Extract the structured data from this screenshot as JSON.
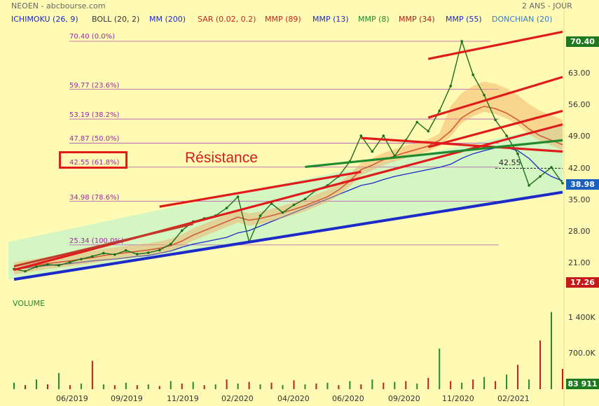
{
  "header": {
    "ticker": "NEOEN - abcbourse.com",
    "period": "2 ANS - JOUR"
  },
  "indicators": [
    {
      "label": "ICHIMOKU (26, 9)",
      "color": "#1b2ac8"
    },
    {
      "label": "BOLL (20, 2)",
      "color": "#333333"
    },
    {
      "label": "MM (200)",
      "color": "#1b2ac8"
    },
    {
      "label": "SAR (0.02, 0.2)",
      "color": "#d11d1d"
    },
    {
      "label": "MMP (89)",
      "color": "#d11d1d"
    },
    {
      "label": "MMP (13)",
      "color": "#1b2ac8"
    },
    {
      "label": "MMP (8)",
      "color": "#1f8a2e"
    },
    {
      "label": "MMP (34)",
      "color": "#a8201a"
    },
    {
      "label": "MMP (55)",
      "color": "#1b2ac8"
    },
    {
      "label": "DONCHIAN (20)",
      "color": "#3a7acb"
    }
  ],
  "price_tags": {
    "top": "70.40",
    "current": "38.98",
    "bottom": "17.26",
    "volume": "83 911"
  },
  "annotation": {
    "text": "Résistance",
    "dotted_level": "42.55"
  },
  "chart_data": {
    "type": "line",
    "title": "",
    "ylim": [
      17.26,
      70.4
    ],
    "yticks": [
      "70.40",
      "63.00",
      "56.00",
      "49.00",
      "42.00",
      "35.00",
      "28.00",
      "21.00"
    ],
    "ytick_values": [
      70.4,
      63,
      56,
      49,
      42,
      35,
      28,
      21
    ],
    "x_labels": [
      "06/2019",
      "09/2019",
      "11/2019",
      "02/2020",
      "04/2020",
      "06/2020",
      "09/2020",
      "11/2020",
      "02/2021"
    ],
    "fibonacci": [
      {
        "label": "70.40 (0.0%)",
        "value": 70.4
      },
      {
        "label": "59.77 (23.6%)",
        "value": 59.77
      },
      {
        "label": "53.19 (38.2%)",
        "value": 53.19
      },
      {
        "label": "47.87 (50.0%)",
        "value": 47.87
      },
      {
        "label": "42.55 (61.8%)",
        "value": 42.55
      },
      {
        "label": "34.98 (78.6%)",
        "value": 34.98
      },
      {
        "label": "25.34 (100.0%)",
        "value": 25.34
      }
    ],
    "price_series": {
      "name": "",
      "values": [
        20,
        19.5,
        20.5,
        21,
        20.8,
        21.5,
        22.2,
        22.8,
        23.5,
        23.2,
        24.1,
        23.3,
        23.6,
        24.2,
        25.5,
        28.5,
        30.5,
        31.2,
        31.8,
        33.5,
        36,
        26,
        31.8,
        34.5,
        32.5,
        34.2,
        35.5,
        37.5,
        38.5,
        40.5,
        43.8,
        49.5,
        46,
        49.5,
        45,
        48.5,
        52.5,
        50.5,
        55,
        60.5,
        70.4,
        63,
        58.5,
        53,
        49.5,
        45.5,
        38.5,
        40.5,
        42.5,
        38.98
      ]
    },
    "mm200": [
      20,
      20.2,
      20.5,
      20.8,
      21,
      21.2,
      21.5,
      21.8,
      22,
      22.2,
      22.5,
      22.8,
      23,
      23.5,
      24,
      24.8,
      25.5,
      26,
      26.5,
      27,
      28,
      28.5,
      29.5,
      30.5,
      31.5,
      32.5,
      33.5,
      34.5,
      35.5,
      36.5,
      37.5,
      38.5,
      39,
      39.8,
      40.5,
      41,
      41.5,
      42,
      42.5,
      43.2,
      44.5,
      45.5,
      46.2,
      46.8,
      46.9,
      46.2,
      44.5,
      42,
      40.5,
      39.5
    ],
    "mmp89": [
      20,
      20.4,
      20.8,
      21.2,
      21.5,
      21.8,
      22.2,
      22.5,
      23,
      23.3,
      23.6,
      23.9,
      24.2,
      24.6,
      25.2,
      26.2,
      27.5,
      28.5,
      29.5,
      30.5,
      31.5,
      30.8,
      31.2,
      31.8,
      32.5,
      33.2,
      34,
      35,
      36,
      37.5,
      39.5,
      42,
      43,
      44.2,
      45,
      45.8,
      46.5,
      47.2,
      48.5,
      50.5,
      53.5,
      55,
      56,
      55.5,
      54.5,
      53,
      51,
      49.5,
      48.5,
      47.5
    ],
    "sar_note": "",
    "trendlines": [
      {
        "from": [
          0,
          19.8
        ],
        "to": [
          49,
          52
        ]
      },
      {
        "from": [
          0,
          17.7
        ],
        "to": [
          49,
          37
        ]
      },
      {
        "from": [
          13,
          33.8
        ],
        "to": [
          31,
          41.5
        ]
      },
      {
        "from": [
          0,
          20.6
        ],
        "to": [
          16,
          30
        ]
      },
      {
        "from": [
          31,
          49
        ],
        "to": [
          49,
          46
        ]
      },
      {
        "from": [
          26,
          42.6
        ],
        "to": [
          49,
          48.5
        ]
      },
      {
        "from": [
          37,
          66.5
        ],
        "to": [
          49,
          72.5
        ]
      },
      {
        "from": [
          37,
          53.5
        ],
        "to": [
          49,
          62.5
        ]
      },
      {
        "from": [
          37,
          47
        ],
        "to": [
          49,
          55
        ]
      }
    ],
    "volume_axis": [
      "1 400K",
      "700.0K"
    ]
  }
}
